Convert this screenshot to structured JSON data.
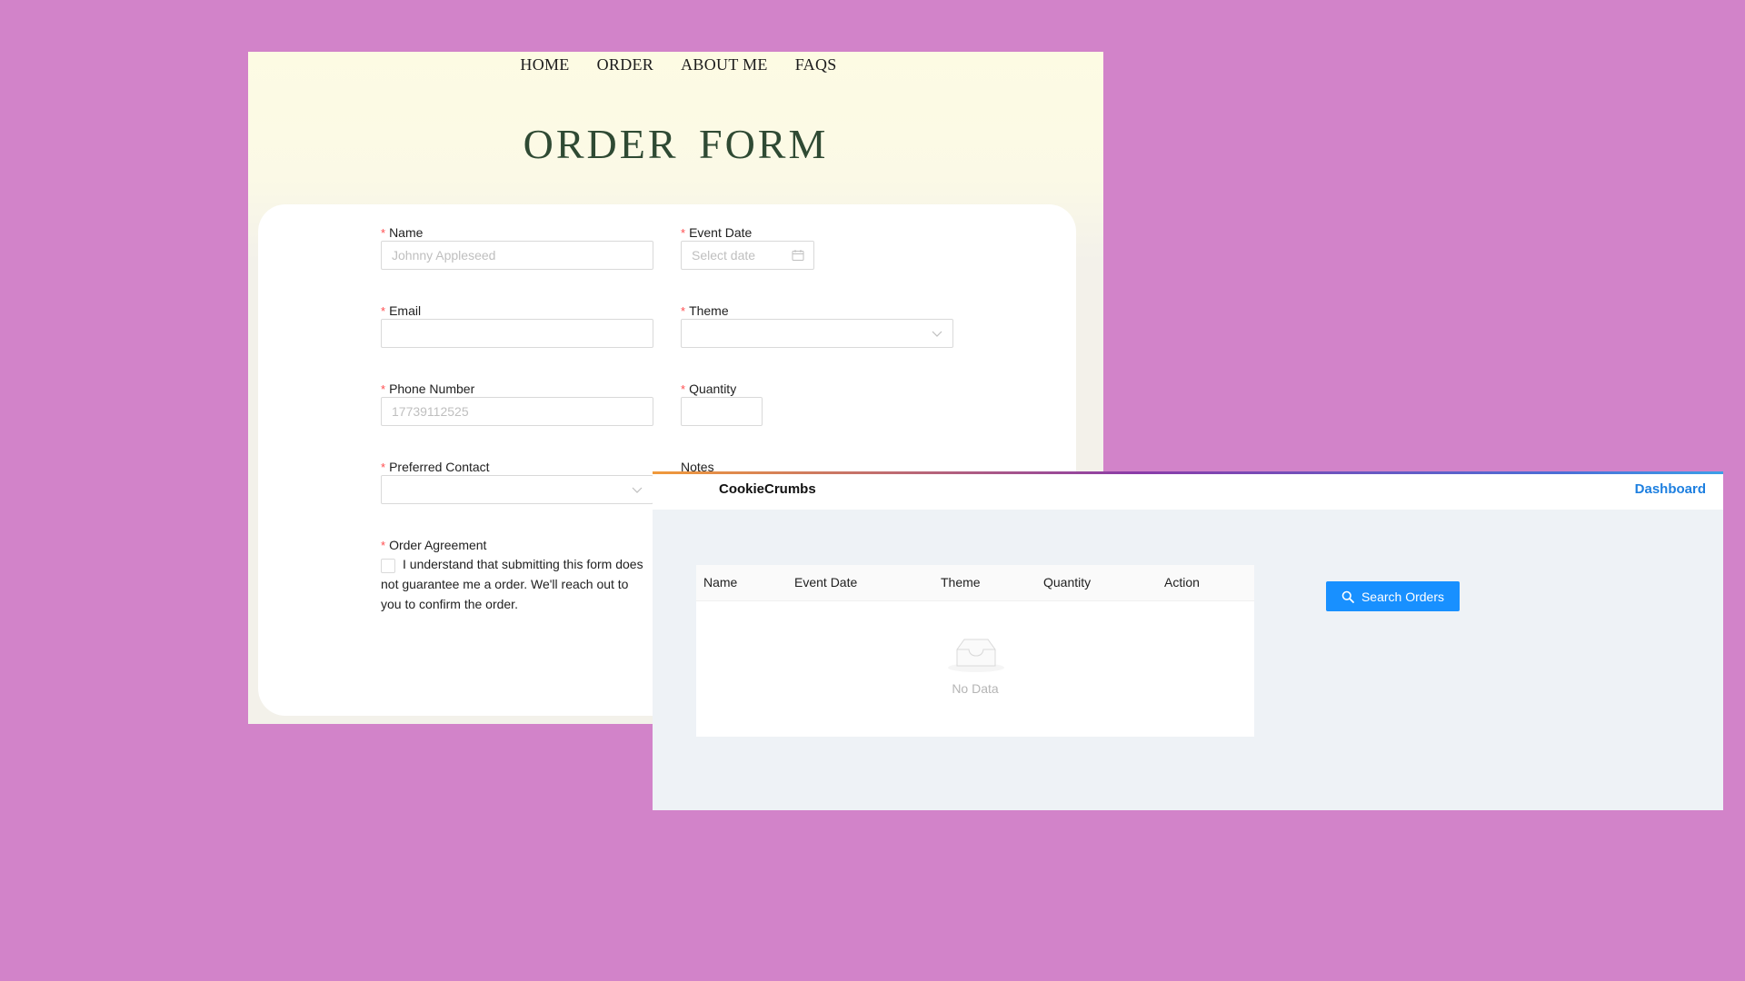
{
  "order_site": {
    "nav": [
      "HOME",
      "ORDER",
      "ABOUT ME",
      "FAQS"
    ],
    "title": "ORDER FORM",
    "fields": {
      "name": {
        "label": "Name",
        "placeholder": "Johnny Appleseed"
      },
      "event_date": {
        "label": "Event Date",
        "placeholder": "Select date"
      },
      "email": {
        "label": "Email",
        "placeholder": ""
      },
      "theme": {
        "label": "Theme",
        "value": ""
      },
      "phone": {
        "label": "Phone Number",
        "placeholder": "17739112525"
      },
      "quantity": {
        "label": "Quantity",
        "value": ""
      },
      "preferred_contact": {
        "label": "Preferred Contact",
        "value": ""
      },
      "notes": {
        "label": "Notes"
      },
      "agreement": {
        "label": "Order Agreement",
        "text": "I understand that submitting this form does not guarantee me a order. We'll reach out to you to confirm the order."
      }
    },
    "required_marker": "*",
    "icons": {
      "date": "calendar-icon",
      "select": "chevron-down-icon"
    }
  },
  "dashboard": {
    "brand": "CookieCrumbs",
    "nav_link": "Dashboard",
    "table": {
      "columns": [
        "Name",
        "Event Date",
        "Theme",
        "Quantity",
        "Action"
      ],
      "rows": [],
      "empty_text": "No Data"
    },
    "search_button": "Search Orders",
    "colors": {
      "primary": "#1890ff",
      "link": "#1d7fe0",
      "heading": "#2f4a33",
      "backdrop": "#d283c9"
    }
  }
}
